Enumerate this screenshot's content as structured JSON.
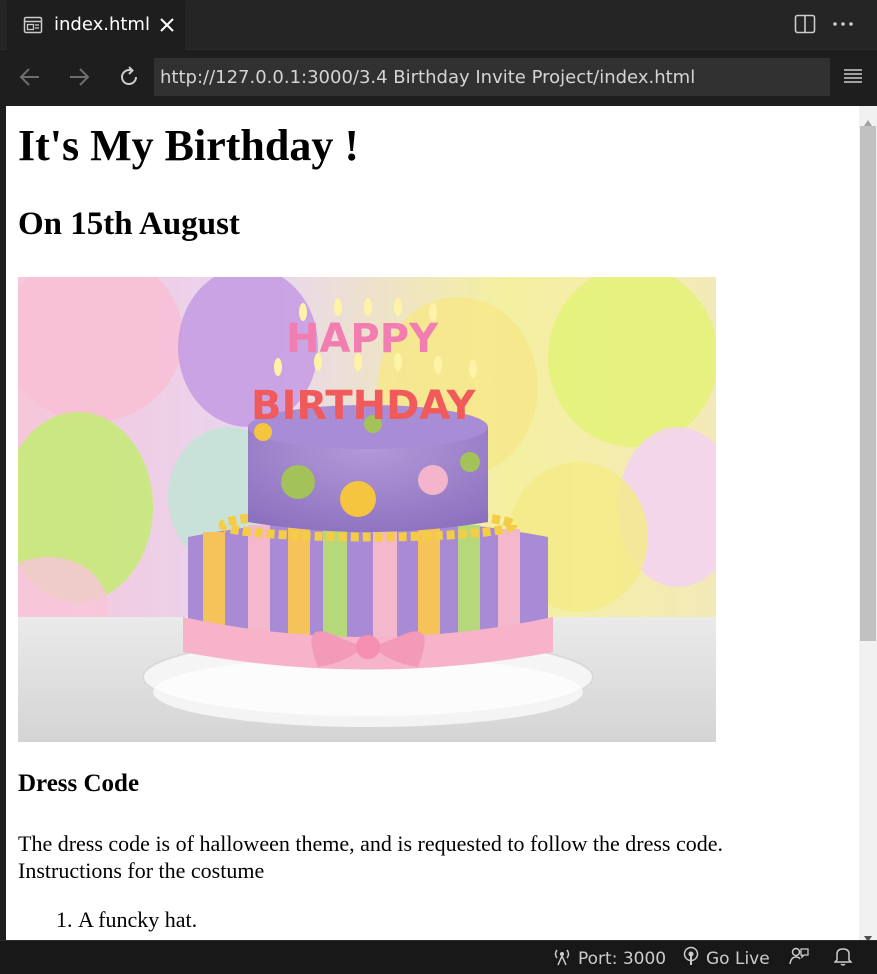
{
  "tab": {
    "label": "index.html"
  },
  "navigation": {
    "url": "http://127.0.0.1:3000/3.4 Birthday Invite Project/index.html"
  },
  "page": {
    "heading": "It's My Birthday !",
    "subheading": "On 15th August",
    "section_title": "Dress Code",
    "paragraph_line1": "The dress code is of halloween theme, and is requested to follow the dress code.",
    "paragraph_line2": "Instructions for the costume",
    "list_items": [
      "A funcky hat."
    ],
    "image_text_line1": "HAPPY",
    "image_text_line2": "BIRTHDAY"
  },
  "statusbar": {
    "port": "Port: 3000",
    "golive": "Go Live"
  },
  "colors": {
    "chrome_bg": "#1e1e1e",
    "tabbar_bg": "#252526",
    "url_bg": "#313131",
    "statusbar_bg": "#181818",
    "page_bg": "#ffffff"
  },
  "icons": {
    "tab": "preview-page-icon",
    "close": "close-icon",
    "split": "split-editor-icon",
    "more": "more-actions-icon",
    "back": "arrow-left-icon",
    "forward": "arrow-right-icon",
    "reload": "reload-icon",
    "menu": "hamburger-menu-icon",
    "port": "broadcast-icon",
    "golive": "podcast-icon",
    "feedback": "feedback-icon",
    "bell": "bell-icon"
  }
}
